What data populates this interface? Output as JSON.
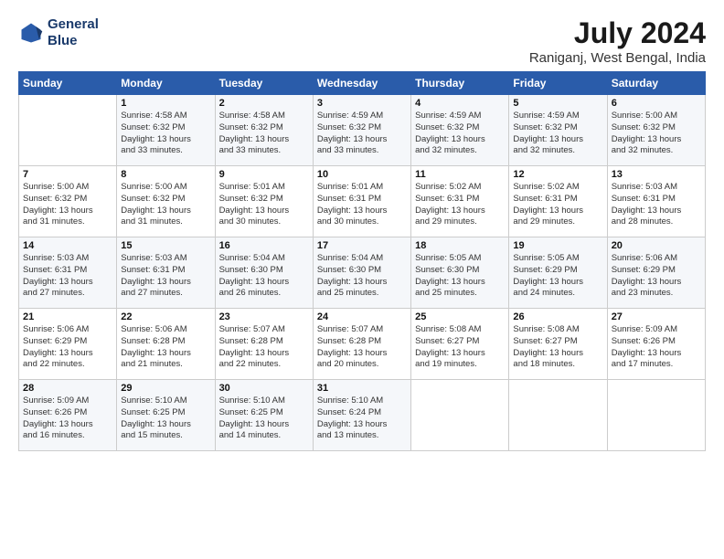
{
  "logo": {
    "line1": "General",
    "line2": "Blue"
  },
  "title": "July 2024",
  "subtitle": "Raniganj, West Bengal, India",
  "days_header": [
    "Sunday",
    "Monday",
    "Tuesday",
    "Wednesday",
    "Thursday",
    "Friday",
    "Saturday"
  ],
  "weeks": [
    [
      {
        "day": "",
        "info": ""
      },
      {
        "day": "1",
        "info": "Sunrise: 4:58 AM\nSunset: 6:32 PM\nDaylight: 13 hours\nand 33 minutes."
      },
      {
        "day": "2",
        "info": "Sunrise: 4:58 AM\nSunset: 6:32 PM\nDaylight: 13 hours\nand 33 minutes."
      },
      {
        "day": "3",
        "info": "Sunrise: 4:59 AM\nSunset: 6:32 PM\nDaylight: 13 hours\nand 33 minutes."
      },
      {
        "day": "4",
        "info": "Sunrise: 4:59 AM\nSunset: 6:32 PM\nDaylight: 13 hours\nand 32 minutes."
      },
      {
        "day": "5",
        "info": "Sunrise: 4:59 AM\nSunset: 6:32 PM\nDaylight: 13 hours\nand 32 minutes."
      },
      {
        "day": "6",
        "info": "Sunrise: 5:00 AM\nSunset: 6:32 PM\nDaylight: 13 hours\nand 32 minutes."
      }
    ],
    [
      {
        "day": "7",
        "info": "Sunrise: 5:00 AM\nSunset: 6:32 PM\nDaylight: 13 hours\nand 31 minutes."
      },
      {
        "day": "8",
        "info": "Sunrise: 5:00 AM\nSunset: 6:32 PM\nDaylight: 13 hours\nand 31 minutes."
      },
      {
        "day": "9",
        "info": "Sunrise: 5:01 AM\nSunset: 6:32 PM\nDaylight: 13 hours\nand 30 minutes."
      },
      {
        "day": "10",
        "info": "Sunrise: 5:01 AM\nSunset: 6:31 PM\nDaylight: 13 hours\nand 30 minutes."
      },
      {
        "day": "11",
        "info": "Sunrise: 5:02 AM\nSunset: 6:31 PM\nDaylight: 13 hours\nand 29 minutes."
      },
      {
        "day": "12",
        "info": "Sunrise: 5:02 AM\nSunset: 6:31 PM\nDaylight: 13 hours\nand 29 minutes."
      },
      {
        "day": "13",
        "info": "Sunrise: 5:03 AM\nSunset: 6:31 PM\nDaylight: 13 hours\nand 28 minutes."
      }
    ],
    [
      {
        "day": "14",
        "info": "Sunrise: 5:03 AM\nSunset: 6:31 PM\nDaylight: 13 hours\nand 27 minutes."
      },
      {
        "day": "15",
        "info": "Sunrise: 5:03 AM\nSunset: 6:31 PM\nDaylight: 13 hours\nand 27 minutes."
      },
      {
        "day": "16",
        "info": "Sunrise: 5:04 AM\nSunset: 6:30 PM\nDaylight: 13 hours\nand 26 minutes."
      },
      {
        "day": "17",
        "info": "Sunrise: 5:04 AM\nSunset: 6:30 PM\nDaylight: 13 hours\nand 25 minutes."
      },
      {
        "day": "18",
        "info": "Sunrise: 5:05 AM\nSunset: 6:30 PM\nDaylight: 13 hours\nand 25 minutes."
      },
      {
        "day": "19",
        "info": "Sunrise: 5:05 AM\nSunset: 6:29 PM\nDaylight: 13 hours\nand 24 minutes."
      },
      {
        "day": "20",
        "info": "Sunrise: 5:06 AM\nSunset: 6:29 PM\nDaylight: 13 hours\nand 23 minutes."
      }
    ],
    [
      {
        "day": "21",
        "info": "Sunrise: 5:06 AM\nSunset: 6:29 PM\nDaylight: 13 hours\nand 22 minutes."
      },
      {
        "day": "22",
        "info": "Sunrise: 5:06 AM\nSunset: 6:28 PM\nDaylight: 13 hours\nand 21 minutes."
      },
      {
        "day": "23",
        "info": "Sunrise: 5:07 AM\nSunset: 6:28 PM\nDaylight: 13 hours\nand 22 minutes."
      },
      {
        "day": "24",
        "info": "Sunrise: 5:07 AM\nSunset: 6:28 PM\nDaylight: 13 hours\nand 20 minutes."
      },
      {
        "day": "25",
        "info": "Sunrise: 5:08 AM\nSunset: 6:27 PM\nDaylight: 13 hours\nand 19 minutes."
      },
      {
        "day": "26",
        "info": "Sunrise: 5:08 AM\nSunset: 6:27 PM\nDaylight: 13 hours\nand 18 minutes."
      },
      {
        "day": "27",
        "info": "Sunrise: 5:09 AM\nSunset: 6:26 PM\nDaylight: 13 hours\nand 17 minutes."
      }
    ],
    [
      {
        "day": "28",
        "info": "Sunrise: 5:09 AM\nSunset: 6:26 PM\nDaylight: 13 hours\nand 16 minutes."
      },
      {
        "day": "29",
        "info": "Sunrise: 5:10 AM\nSunset: 6:25 PM\nDaylight: 13 hours\nand 15 minutes."
      },
      {
        "day": "30",
        "info": "Sunrise: 5:10 AM\nSunset: 6:25 PM\nDaylight: 13 hours\nand 14 minutes."
      },
      {
        "day": "31",
        "info": "Sunrise: 5:10 AM\nSunset: 6:24 PM\nDaylight: 13 hours\nand 13 minutes."
      },
      {
        "day": "",
        "info": ""
      },
      {
        "day": "",
        "info": ""
      },
      {
        "day": "",
        "info": ""
      }
    ]
  ]
}
